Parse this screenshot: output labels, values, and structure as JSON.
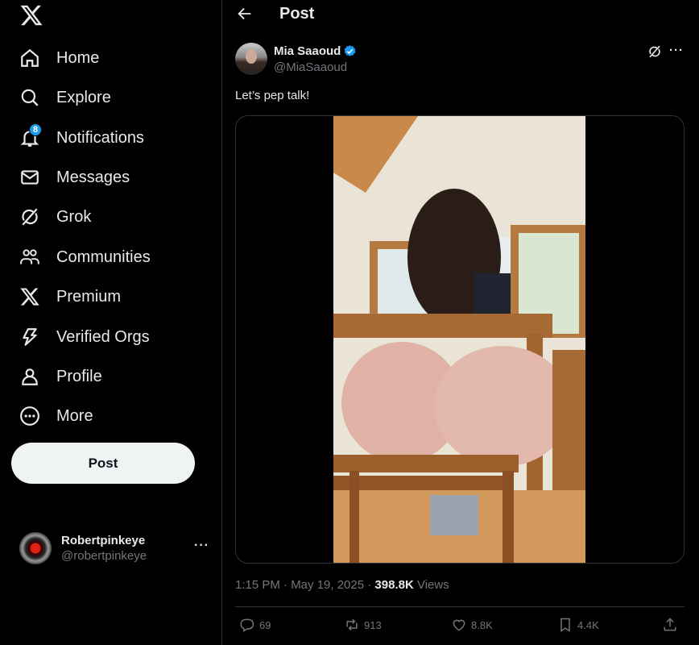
{
  "sidebar": {
    "logo": "x-logo-icon",
    "items": [
      {
        "label": "Home",
        "icon": "home-icon"
      },
      {
        "label": "Explore",
        "icon": "search-icon"
      },
      {
        "label": "Notifications",
        "icon": "bell-icon",
        "badge": "8"
      },
      {
        "label": "Messages",
        "icon": "envelope-icon"
      },
      {
        "label": "Grok",
        "icon": "grok-icon"
      },
      {
        "label": "Communities",
        "icon": "communities-icon"
      },
      {
        "label": "Premium",
        "icon": "x-icon"
      },
      {
        "label": "Verified Orgs",
        "icon": "lightning-icon"
      },
      {
        "label": "Profile",
        "icon": "person-icon"
      },
      {
        "label": "More",
        "icon": "more-circle-icon"
      }
    ],
    "post_button": "Post",
    "account": {
      "name": "Robertpinkeye",
      "handle": "@robertpinkeye",
      "more": "···"
    }
  },
  "header": {
    "title": "Post"
  },
  "post": {
    "author_name": "Mia Saaoud",
    "author_handle": "@MiaSaaoud",
    "more": "···",
    "text": "Let’s pep talk!",
    "time": "1:15 PM · May 19, 2025 · ",
    "views_count": "398.8K",
    "views_label": " Views",
    "stats": {
      "replies": "69",
      "reposts": "913",
      "likes": "8.8K",
      "bookmarks": "4.4K"
    }
  },
  "colors": {
    "background": "#000000",
    "text": "#e7e9ea",
    "muted": "#71767b",
    "accent": "#1d9bf0",
    "border": "#2f3336"
  }
}
